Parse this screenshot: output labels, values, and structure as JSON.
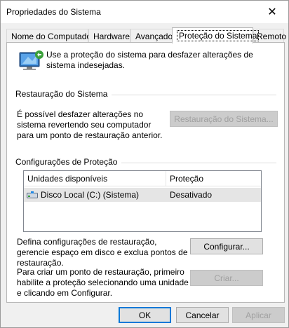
{
  "window": {
    "title": "Propriedades do Sistema",
    "close_glyph": "✕"
  },
  "tabs": [
    {
      "label": "Nome do Computador"
    },
    {
      "label": "Hardware"
    },
    {
      "label": "Avançado"
    },
    {
      "label": "Proteção do Sistema",
      "active": true
    },
    {
      "label": "Remoto"
    }
  ],
  "intro": {
    "icon": "system-protection-icon",
    "text": "Use a proteção do sistema para desfazer alterações de sistema indesejadas."
  },
  "restore_group": {
    "label": "Restauração do Sistema",
    "description": "É possível desfazer alterações no sistema revertendo seu computador para um ponto de restauração anterior.",
    "button_label": "Restauração do Sistema...",
    "button_enabled": false
  },
  "protection_group": {
    "label": "Configurações de Proteção",
    "columns": [
      "Unidades disponíveis",
      "Proteção"
    ],
    "rows": [
      {
        "drive": "Disco Local (C:) (Sistema)",
        "protection": "Desativado",
        "icon": "hard-disk-icon"
      }
    ],
    "configure_text": "Defina configurações de restauração, gerencie espaço em disco e exclua pontos de restauração.",
    "configure_button": "Configurar...",
    "create_text": "Para criar um ponto de restauração, primeiro habilite a proteção selecionando uma unidade e clicando em Configurar.",
    "create_button": "Criar...",
    "create_enabled": false
  },
  "footer": {
    "ok": "OK",
    "cancel": "Cancelar",
    "apply": "Aplicar",
    "apply_enabled": false
  },
  "colors": {
    "window_bg": "#f0f0f0",
    "panel_bg": "#ffffff",
    "selected_row": "#e5e5e5",
    "default_button_border": "#0078d7",
    "disabled_text": "#a0a0a0"
  }
}
